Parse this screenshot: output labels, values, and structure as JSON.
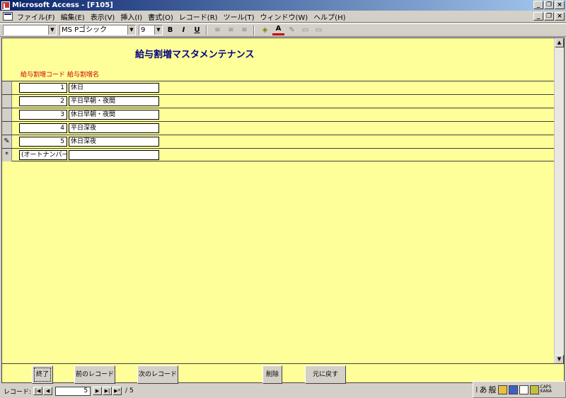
{
  "window": {
    "title": "Microsoft Access - [F105]"
  },
  "menu": {
    "items": [
      "ファイル(F)",
      "編集(E)",
      "表示(V)",
      "挿入(I)",
      "書式(O)",
      "レコード(R)",
      "ツール(T)",
      "ウィンドウ(W)",
      "ヘルプ(H)"
    ]
  },
  "toolbar": {
    "object_combo": "",
    "font_name": "MS Pゴシック",
    "font_size": "9",
    "bold": "B",
    "italic": "I",
    "underline": "U"
  },
  "form": {
    "title": "給与割増マスタメンテナンス",
    "headers": {
      "code": "給与割増コード",
      "name": "給与割増名"
    },
    "rows": [
      {
        "selector": "",
        "code": "1",
        "name": "休日"
      },
      {
        "selector": "",
        "code": "2",
        "name": "平日早朝・夜間"
      },
      {
        "selector": "",
        "code": "3",
        "name": "休日早朝・夜間"
      },
      {
        "selector": "",
        "code": "4",
        "name": "平日深夜"
      },
      {
        "selector": "✎",
        "code": "5",
        "name": "休日深夜"
      },
      {
        "selector": "*",
        "code": "(オートナンバー)",
        "name": ""
      }
    ],
    "buttons": {
      "exit": "終了",
      "prev": "前のレコード",
      "next": "次のレコード",
      "delete": "削除",
      "undo": "元に戻す"
    }
  },
  "nav": {
    "label": "レコード:",
    "current": "5",
    "total": "/ 5"
  },
  "tray": {
    "ime_hira": "あ",
    "ime_mode": "般",
    "caps": "CAPS",
    "kana": "KANA"
  },
  "colors": {
    "form_bg": "#ffff99",
    "header_red": "#cc0000",
    "title_navy": "#000080"
  }
}
